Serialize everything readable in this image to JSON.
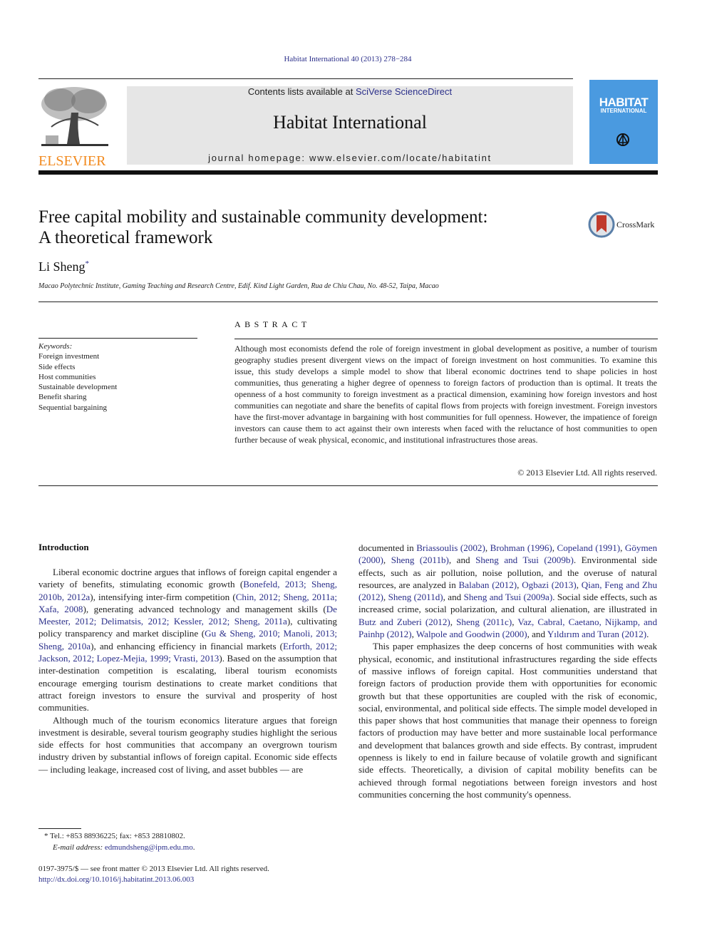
{
  "header": {
    "running_citation": "Habitat International 40 (2013) 278−284",
    "publisher_wordmark": "ELSEVIER",
    "contents_prefix": "Contents lists available at ",
    "contents_link": "SciVerse ScienceDirect",
    "journal_title": "Habitat International",
    "homepage": "journal homepage: www.elsevier.com/locate/habitatint",
    "cover": {
      "line1": "HABITAT",
      "line2": "INTERNATIONAL",
      "color": "#4a9ae0"
    }
  },
  "article": {
    "title_line1": "Free capital mobility and sustainable community development:",
    "title_line2": "A theoretical framework",
    "crossmark_label": "CrossMark",
    "author": "Li Sheng",
    "author_mark": "*",
    "affiliation": "Macao Polytechnic Institute, Gaming Teaching and Research Centre, Edif. Kind Light Garden, Rua de Chiu Chau, No. 48-52, Taipa, Macao"
  },
  "keywords": {
    "heading": "Keywords:",
    "items": [
      "Foreign investment",
      "Side effects",
      "Host communities",
      "Sustainable development",
      "Benefit sharing",
      "Sequential bargaining"
    ]
  },
  "abstract": {
    "heading": "ABSTRACT",
    "text": "Although most economists defend the role of foreign investment in global development as positive, a number of tourism geography studies present divergent views on the impact of foreign investment on host communities. To examine this issue, this study develops a simple model to show that liberal economic doctrines tend to shape policies in host communities, thus generating a higher degree of openness to foreign factors of production than is optimal. It treats the openness of a host community to foreign investment as a practical dimension, examining how foreign investors and host communities can negotiate and share the benefits of capital flows from projects with foreign investment. Foreign investors have the first-mover advantage in bargaining with host communities for full openness. However, the impatience of foreign investors can cause them to act against their own interests when faced with the reluctance of host communities to open further because of weak physical, economic, and institutional infrastructures those areas.",
    "copyright": "© 2013 Elsevier Ltd. All rights reserved."
  },
  "body": {
    "section_heading": "Introduction",
    "left": {
      "p1": [
        {
          "t": "Liberal economic doctrine argues that inflows of foreign capital engender a variety of benefits, stimulating economic growth ("
        },
        {
          "t": "Bonefeld, 2013; Sheng, 2010b, 2012a",
          "link": true
        },
        {
          "t": "), intensifying inter-firm competition ("
        },
        {
          "t": "Chin, 2012; Sheng, 2011a; Xafa, 2008",
          "link": true
        },
        {
          "t": "), generating advanced technology and management skills ("
        },
        {
          "t": "De Meester, 2012; Delimatsis, 2012; Kessler, 2012; Sheng, 2011a",
          "link": true
        },
        {
          "t": "), cultivating policy transparency and market discipline ("
        },
        {
          "t": "Gu & Sheng, 2010; Manoli, 2013; Sheng, 2010a",
          "link": true
        },
        {
          "t": "), and enhancing efficiency in financial markets ("
        },
        {
          "t": "Erforth, 2012; Jackson, 2012; Lopez-Mejia, 1999; Vrasti, 2013",
          "link": true
        },
        {
          "t": "). Based on the assumption that inter-destination competition is escalating, liberal tourism economists encourage emerging tourism destinations to create market conditions that attract foreign investors to ensure the survival and prosperity of host communities."
        }
      ],
      "p2": [
        {
          "t": "Although much of the tourism economics literature argues that foreign investment is desirable, several tourism geography studies highlight the serious side effects for host communities that accompany an overgrown tourism industry driven by substantial inflows of foreign capital. Economic side effects — including leakage, increased cost of living, and asset bubbles — are"
        }
      ]
    },
    "right": {
      "p1": [
        {
          "t": "documented in "
        },
        {
          "t": "Briassoulis (2002)",
          "link": true
        },
        {
          "t": ", "
        },
        {
          "t": "Brohman (1996)",
          "link": true
        },
        {
          "t": ", "
        },
        {
          "t": "Copeland (1991)",
          "link": true
        },
        {
          "t": ", "
        },
        {
          "t": "Göymen (2000)",
          "link": true
        },
        {
          "t": ", "
        },
        {
          "t": "Sheng (2011b)",
          "link": true
        },
        {
          "t": ", and "
        },
        {
          "t": "Sheng and Tsui (2009b)",
          "link": true
        },
        {
          "t": ". Environmental side effects, such as air pollution, noise pollution, and the overuse of natural resources, are analyzed in "
        },
        {
          "t": "Balaban (2012)",
          "link": true
        },
        {
          "t": ", "
        },
        {
          "t": "Ogbazi (2013)",
          "link": true
        },
        {
          "t": ", "
        },
        {
          "t": "Qian, Feng and Zhu (2012)",
          "link": true
        },
        {
          "t": ", "
        },
        {
          "t": "Sheng (2011d)",
          "link": true
        },
        {
          "t": ", and "
        },
        {
          "t": "Sheng and Tsui (2009a)",
          "link": true
        },
        {
          "t": ". Social side effects, such as increased crime, social polarization, and cultural alienation, are illustrated in "
        },
        {
          "t": "Butz and Zuberi (2012)",
          "link": true
        },
        {
          "t": ", "
        },
        {
          "t": "Sheng (2011c)",
          "link": true
        },
        {
          "t": ", "
        },
        {
          "t": "Vaz, Cabral, Caetano, Nijkamp, and Painhp (2012)",
          "link": true
        },
        {
          "t": ", "
        },
        {
          "t": "Walpole and Goodwin (2000)",
          "link": true
        },
        {
          "t": ", and "
        },
        {
          "t": "Yıldırım and Turan (2012)",
          "link": true
        },
        {
          "t": "."
        }
      ],
      "p2": [
        {
          "t": "This paper emphasizes the deep concerns of host communities with weak physical, economic, and institutional infrastructures regarding the side effects of massive inflows of foreign capital. Host communities understand that foreign factors of production provide them with opportunities for economic growth but that these opportunities are coupled with the risk of economic, social, environmental, and political side effects. The simple model developed in this paper shows that host communities that manage their openness to foreign factors of production may have better and more sustainable local performance and development that balances growth and side effects. By contrast, imprudent openness is likely to end in failure because of volatile growth and significant side effects. Theoretically, a division of capital mobility benefits can be achieved through formal negotiations between foreign investors and host communities concerning the host community's openness."
        }
      ]
    }
  },
  "footnote": {
    "tel": "* Tel.: +853 88936225; fax: +853 28810802.",
    "email_label": "E-mail address: ",
    "email": "edmundsheng@ipm.edu.mo",
    "email_suffix": "."
  },
  "issn": {
    "line": "0197-3975/$ — see front matter © 2013 Elsevier Ltd. All rights reserved.",
    "doi": "http://dx.doi.org/10.1016/j.habitatint.2013.06.003"
  }
}
